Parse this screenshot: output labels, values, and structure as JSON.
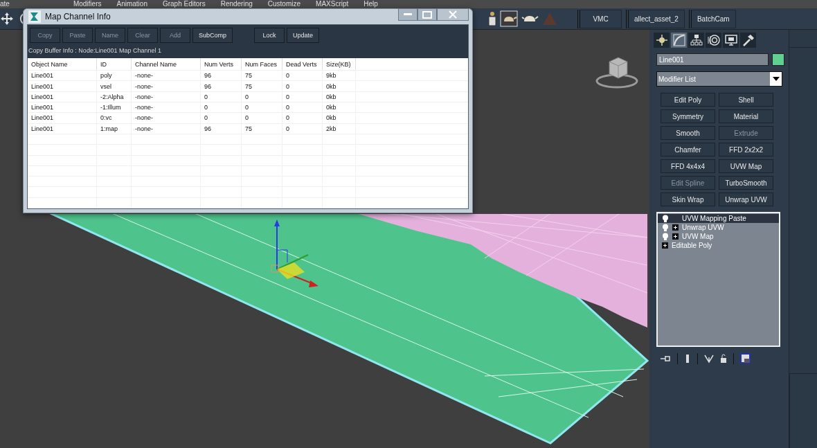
{
  "menu_bar": [
    "ate",
    "Modifiers",
    "Animation",
    "Graph Editors",
    "Rendering",
    "Customize",
    "MAXScript",
    "Help"
  ],
  "toolbar": {
    "tabs": [
      "VMC",
      "allect_asset_2",
      "BatchCam"
    ]
  },
  "dialog": {
    "title": "Map Channel Info",
    "buttons": [
      {
        "label": "Copy",
        "disabled": true
      },
      {
        "label": "Paste",
        "disabled": true
      },
      {
        "label": "Name",
        "disabled": true
      },
      {
        "label": "Clear",
        "disabled": true
      },
      {
        "label": "Add",
        "disabled": true
      },
      {
        "label": "SubComp",
        "disabled": false
      },
      {
        "label": "Lock",
        "disabled": false
      },
      {
        "label": "Update",
        "disabled": false
      }
    ],
    "info": "Copy Buffer Info : Node:Line001 Map Channel 1",
    "columns": [
      "Object Name",
      "ID",
      "Channel Name",
      "Num Verts",
      "Num Faces",
      "Dead Verts",
      "Size(KB)"
    ],
    "rows": [
      [
        "Line001",
        "poly",
        "-none-",
        "96",
        "75",
        "0",
        "9kb"
      ],
      [
        "Line001",
        "vsel",
        "-none-",
        "96",
        "75",
        "0",
        "0kb"
      ],
      [
        "Line001",
        "-2:Alpha",
        "-none-",
        "0",
        "0",
        "0",
        "0kb"
      ],
      [
        "Line001",
        "-1:Illum",
        "-none-",
        "0",
        "0",
        "0",
        "0kb"
      ],
      [
        "Line001",
        "0:vc",
        "-none-",
        "0",
        "0",
        "0",
        "0kb"
      ],
      [
        "Line001",
        "1:map",
        "-none-",
        "96",
        "75",
        "0",
        "2kb"
      ]
    ]
  },
  "command_panel": {
    "tabs": [
      {
        "kind": "create",
        "selected": false
      },
      {
        "kind": "modify",
        "selected": true
      },
      {
        "kind": "hierarchy",
        "selected": false
      },
      {
        "kind": "motion",
        "selected": false
      },
      {
        "kind": "display",
        "selected": false
      },
      {
        "kind": "utilities",
        "selected": false
      }
    ],
    "object_name": "Line001",
    "modifier_list": "Modifier List",
    "modifier_buttons": [
      {
        "label": "Edit Poly",
        "disabled": false
      },
      {
        "label": "Shell",
        "disabled": false
      },
      {
        "label": "Symmetry",
        "disabled": false
      },
      {
        "label": "Material",
        "disabled": false
      },
      {
        "label": "Smooth",
        "disabled": false
      },
      {
        "label": "Extrude",
        "disabled": true
      },
      {
        "label": "Chamfer",
        "disabled": false
      },
      {
        "label": "FFD 2x2x2",
        "disabled": false
      },
      {
        "label": "FFD 4x4x4",
        "disabled": false
      },
      {
        "label": "UVW Map",
        "disabled": false
      },
      {
        "label": "Edit Spline",
        "disabled": true
      },
      {
        "label": "TurboSmooth",
        "disabled": false
      },
      {
        "label": "Skin Wrap",
        "disabled": false
      },
      {
        "label": "Unwrap UVW",
        "disabled": false
      }
    ],
    "stack": [
      {
        "label": "UVW Mapping Paste",
        "kind": "modifier",
        "expandable": false,
        "selected": true
      },
      {
        "label": "Unwrap UVW",
        "kind": "modifier",
        "expandable": true,
        "selected": false
      },
      {
        "label": "UVW Map",
        "kind": "modifier",
        "expandable": true,
        "selected": false
      },
      {
        "label": "Editable Poly",
        "kind": "base",
        "expandable": true,
        "selected": false
      }
    ]
  }
}
